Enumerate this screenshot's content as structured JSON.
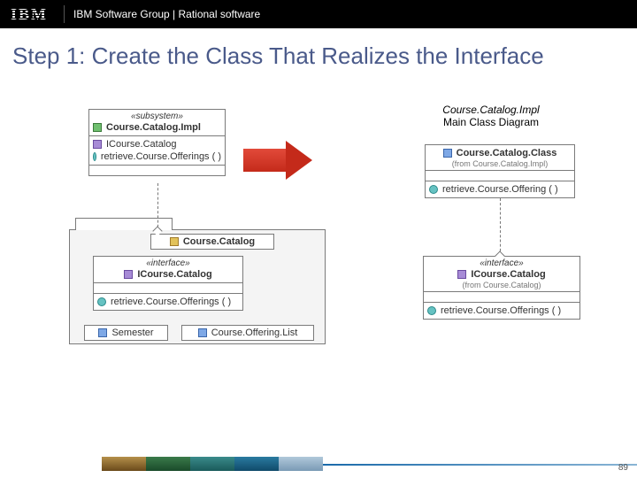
{
  "header": {
    "logo_text": "IBM",
    "breadcrumb": "IBM Software Group | Rational software"
  },
  "title": "Step 1: Create the Class That Realizes the Interface",
  "caption": {
    "line1": "Course.Catalog.Impl",
    "line2": "Main Class Diagram"
  },
  "uml": {
    "subsystem": {
      "stereotype": "«subsystem»",
      "name": "Course.Catalog.Impl",
      "provides": "ICourse.Catalog",
      "op": "retrieve.Course.Offerings ( )"
    },
    "course_catalog_pkg": {
      "name": "Course.Catalog",
      "interface_stereo": "«interface»",
      "interface_name": "ICourse.Catalog",
      "interface_op": "retrieve.Course.Offerings ( )",
      "class_semester": "Semester",
      "class_offeringlist": "Course.Offering.List"
    },
    "impl_class": {
      "name": "Course.Catalog.Class",
      "from": "(from Course.Catalog.Impl)",
      "op": "retrieve.Course.Offering ( )"
    },
    "icatalog_right": {
      "stereotype": "«interface»",
      "name": "ICourse.Catalog",
      "from": "(from Course.Catalog)",
      "op": "retrieve.Course.Offerings ( )"
    }
  },
  "page_number": "89"
}
